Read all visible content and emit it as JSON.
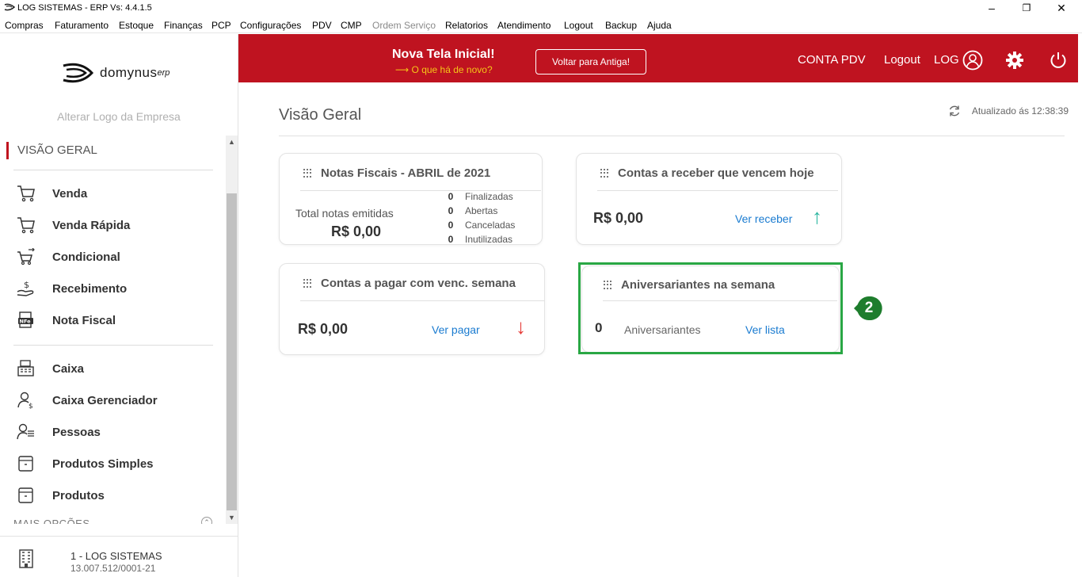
{
  "window": {
    "title": "LOG SISTEMAS - ERP Vs: 4.4.1.5",
    "controls": {
      "minimize": "–",
      "restore": "❐",
      "close": "✕"
    }
  },
  "menu": [
    {
      "label": "Compras",
      "disabled": false
    },
    {
      "label": "Faturamento",
      "disabled": false
    },
    {
      "label": "Estoque",
      "disabled": false
    },
    {
      "label": "Finanças",
      "disabled": false
    },
    {
      "label": "PCP",
      "disabled": false
    },
    {
      "label": "Configurações",
      "disabled": false
    },
    {
      "label": "PDV",
      "disabled": false
    },
    {
      "label": "CMP",
      "disabled": false
    },
    {
      "label": "Ordem Serviço",
      "disabled": true
    },
    {
      "label": "Relatorios",
      "disabled": false
    },
    {
      "label": "Atendimento",
      "disabled": false
    },
    {
      "label": "Logout",
      "disabled": false
    },
    {
      "label": "Backup",
      "disabled": false
    },
    {
      "label": "Ajuda",
      "disabled": false
    }
  ],
  "sidebar": {
    "logo_text": "domynus",
    "logo_suffix": "erp",
    "alter_logo": "Alterar Logo da Empresa",
    "section": "VISÃO GERAL",
    "items_group1": [
      {
        "label": "Venda",
        "icon": "cart-icon"
      },
      {
        "label": "Venda Rápida",
        "icon": "cart-icon"
      },
      {
        "label": "Condicional",
        "icon": "cart-exchange-icon"
      },
      {
        "label": "Recebimento",
        "icon": "hand-money-icon"
      },
      {
        "label": "Nota Fiscal",
        "icon": "nfe-icon"
      }
    ],
    "items_group2": [
      {
        "label": "Caixa",
        "icon": "cash-register-icon"
      },
      {
        "label": "Caixa Gerenciador",
        "icon": "user-money-icon"
      },
      {
        "label": "Pessoas",
        "icon": "people-list-icon"
      },
      {
        "label": "Produtos Simples",
        "icon": "box-icon"
      },
      {
        "label": "Produtos",
        "icon": "box-icon"
      }
    ],
    "more": "MAIS OPÇÕES",
    "company_name": "1 - LOG SISTEMAS",
    "company_cnpj": "13.007.512/0001-21"
  },
  "header": {
    "new_title": "Nova Tela Inicial!",
    "new_sub": "⟶ O que há de novo?",
    "back_button": "Voltar para Antiga!",
    "conta_pdv": "CONTA PDV",
    "logout": "Logout",
    "user": "LOG"
  },
  "main": {
    "title": "Visão Geral",
    "updated": "Atualizado ás 12:38:39",
    "notas": {
      "title": "Notas Fiscais - ABRIL de 2021",
      "total_label": "Total notas emitidas",
      "total_value": "R$ 0,00",
      "stats": [
        {
          "value": "0",
          "label": "Finalizadas"
        },
        {
          "value": "0",
          "label": "Abertas"
        },
        {
          "value": "0",
          "label": "Canceladas"
        },
        {
          "value": "0",
          "label": "Inutilizadas"
        }
      ]
    },
    "receber": {
      "title": "Contas a receber que vencem hoje",
      "value": "R$ 0,00",
      "link": "Ver receber",
      "arrow": "↑"
    },
    "pagar": {
      "title": "Contas a pagar com venc. semana",
      "value": "R$ 0,00",
      "link": "Ver pagar",
      "arrow": "↓"
    },
    "aniversariantes": {
      "title": "Aniversariantes na semana",
      "count": "0",
      "label": "Aniversariantes",
      "link": "Ver lista"
    },
    "badge": "2"
  },
  "colors": {
    "brand_red": "#bf1320",
    "link_blue": "#1a7bd0",
    "up_arrow": "#2bb5a0",
    "down_arrow": "#e53935",
    "highlight_green": "#29a744",
    "badge_green": "#1e7d2d"
  }
}
